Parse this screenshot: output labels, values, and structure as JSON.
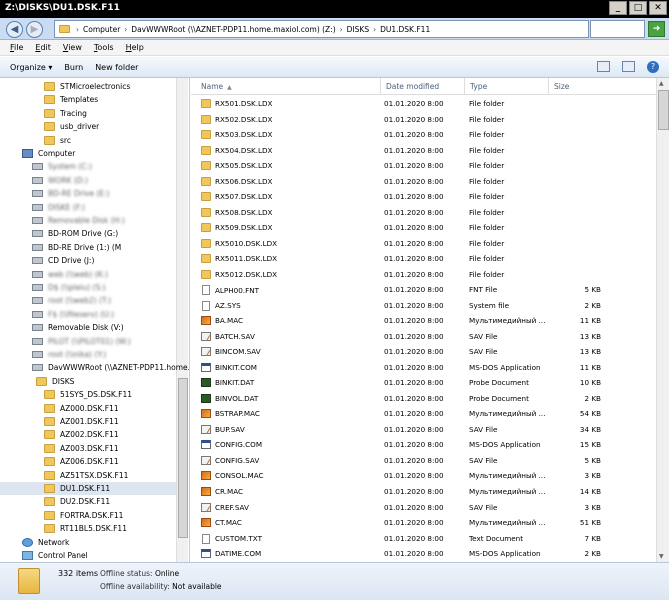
{
  "window": {
    "title": "Z:\\DISKS\\DU1.DSK.F11"
  },
  "address": {
    "crumbs": [
      "Computer",
      "DavWWWRoot (\\\\AZNET-PDP11.home.maxiol.com) (Z:)",
      "DISKS",
      "DU1.DSK.F11"
    ]
  },
  "menu": {
    "items": [
      "File",
      "Edit",
      "View",
      "Tools",
      "Help"
    ]
  },
  "toolbar": {
    "organize": "Organize ▾",
    "burn": "Burn",
    "new_folder": "New folder"
  },
  "columns": {
    "name": "Name",
    "date": "Date modified",
    "type": "Type",
    "size": "Size"
  },
  "nav": {
    "items": [
      {
        "label": "STMicroelectronics",
        "icon": "folder",
        "indent": 44
      },
      {
        "label": "Templates",
        "icon": "folder",
        "indent": 44
      },
      {
        "label": "Tracing",
        "icon": "folder",
        "indent": 44
      },
      {
        "label": "usb_driver",
        "icon": "folder",
        "indent": 44
      },
      {
        "label": "src",
        "icon": "folder",
        "indent": 44
      },
      {
        "label": "Computer",
        "icon": "comp",
        "indent": 22
      },
      {
        "label": "System (C:)",
        "icon": "drive",
        "indent": 32,
        "blur": true
      },
      {
        "label": "WORK (D:)",
        "icon": "drive",
        "indent": 32,
        "blur": true
      },
      {
        "label": "BD-RE Drive (E:)",
        "icon": "drive",
        "indent": 32,
        "blur": true
      },
      {
        "label": "DISKE (F:)",
        "icon": "drive",
        "indent": 32,
        "blur": true
      },
      {
        "label": "Removable Disk (H:)",
        "icon": "drive",
        "indent": 32,
        "blur": true
      },
      {
        "label": "BD-ROM Drive (G:)",
        "icon": "drive",
        "indent": 32
      },
      {
        "label": "BD-RE Drive (1:) (M",
        "icon": "drive",
        "indent": 32
      },
      {
        "label": "CD Drive (J:)",
        "icon": "drive",
        "indent": 32
      },
      {
        "label": "web (\\\\web) (K:)",
        "icon": "drive",
        "indent": 32,
        "blur": true
      },
      {
        "label": "D$ (\\\\pleiu) (S:)",
        "icon": "drive",
        "indent": 32,
        "blur": true
      },
      {
        "label": "root (\\\\web2) (T:)",
        "icon": "drive",
        "indent": 32,
        "blur": true
      },
      {
        "label": "F$ (\\\\fileserv) (U:)",
        "icon": "drive",
        "indent": 32,
        "blur": true
      },
      {
        "label": "Removable Disk (V:)",
        "icon": "drive",
        "indent": 32
      },
      {
        "label": "PILOT (\\\\PILOT01) (W:)",
        "icon": "drive",
        "indent": 32,
        "blur": true
      },
      {
        "label": "root (\\\\nika) (Y:)",
        "icon": "drive",
        "indent": 32,
        "blur": true
      },
      {
        "label": "DavWWWRoot (\\\\AZNET-PDP11.home.",
        "icon": "drive",
        "indent": 32
      },
      {
        "label": "DISKS",
        "icon": "folder",
        "indent": 36
      },
      {
        "label": "51SYS_DS.DSK.F11",
        "icon": "folder",
        "indent": 44
      },
      {
        "label": "AZ000.DSK.F11",
        "icon": "folder",
        "indent": 44
      },
      {
        "label": "AZ001.DSK.F11",
        "icon": "folder",
        "indent": 44
      },
      {
        "label": "AZ002.DSK.F11",
        "icon": "folder",
        "indent": 44
      },
      {
        "label": "AZ003.DSK.F11",
        "icon": "folder",
        "indent": 44
      },
      {
        "label": "AZ006.DSK.F11",
        "icon": "folder",
        "indent": 44
      },
      {
        "label": "AZ51TSX.DSK.F11",
        "icon": "folder",
        "indent": 44
      },
      {
        "label": "DU1.DSK.F11",
        "icon": "folder",
        "indent": 44,
        "selected": true
      },
      {
        "label": "DU2.DSK.F11",
        "icon": "folder",
        "indent": 44
      },
      {
        "label": "FORTRA.DSK.F11",
        "icon": "folder",
        "indent": 44
      },
      {
        "label": "RT11BL5.DSK.F11",
        "icon": "folder",
        "indent": 44
      },
      {
        "label": "Network",
        "icon": "net",
        "indent": 22
      },
      {
        "label": "Control Panel",
        "icon": "cp",
        "indent": 22
      }
    ]
  },
  "files": [
    {
      "name": "RX501.DSK.LDX",
      "date": "01.01.2020 8:00",
      "type": "File folder",
      "size": "",
      "icon": "folder"
    },
    {
      "name": "RX502.DSK.LDX",
      "date": "01.01.2020 8:00",
      "type": "File folder",
      "size": "",
      "icon": "folder"
    },
    {
      "name": "RX503.DSK.LDX",
      "date": "01.01.2020 8:00",
      "type": "File folder",
      "size": "",
      "icon": "folder"
    },
    {
      "name": "RX504.DSK.LDX",
      "date": "01.01.2020 8:00",
      "type": "File folder",
      "size": "",
      "icon": "folder"
    },
    {
      "name": "RX505.DSK.LDX",
      "date": "01.01.2020 8:00",
      "type": "File folder",
      "size": "",
      "icon": "folder"
    },
    {
      "name": "RX506.DSK.LDX",
      "date": "01.01.2020 8:00",
      "type": "File folder",
      "size": "",
      "icon": "folder"
    },
    {
      "name": "RX507.DSK.LDX",
      "date": "01.01.2020 8:00",
      "type": "File folder",
      "size": "",
      "icon": "folder"
    },
    {
      "name": "RX508.DSK.LDX",
      "date": "01.01.2020 8:00",
      "type": "File folder",
      "size": "",
      "icon": "folder"
    },
    {
      "name": "RX509.DSK.LDX",
      "date": "01.01.2020 8:00",
      "type": "File folder",
      "size": "",
      "icon": "folder"
    },
    {
      "name": "RX5010.DSK.LDX",
      "date": "01.01.2020 8:00",
      "type": "File folder",
      "size": "",
      "icon": "folder"
    },
    {
      "name": "RX5011.DSK.LDX",
      "date": "01.01.2020 8:00",
      "type": "File folder",
      "size": "",
      "icon": "folder"
    },
    {
      "name": "RX5012.DSK.LDX",
      "date": "01.01.2020 8:00",
      "type": "File folder",
      "size": "",
      "icon": "folder"
    },
    {
      "name": "ALPH00.FNT",
      "date": "01.01.2020 8:00",
      "type": "FNT File",
      "size": "5 KB",
      "icon": "file"
    },
    {
      "name": "AZ.SYS",
      "date": "01.01.2020 8:00",
      "type": "System file",
      "size": "2 KB",
      "icon": "file"
    },
    {
      "name": "BA.MAC",
      "date": "01.01.2020 8:00",
      "type": "Мультимедийный ...",
      "size": "11 KB",
      "icon": "mac"
    },
    {
      "name": "BATCH.SAV",
      "date": "01.01.2020 8:00",
      "type": "SAV File",
      "size": "13 KB",
      "icon": "sav"
    },
    {
      "name": "BINCOM.SAV",
      "date": "01.01.2020 8:00",
      "type": "SAV File",
      "size": "13 KB",
      "icon": "sav"
    },
    {
      "name": "BINKIT.COM",
      "date": "01.01.2020 8:00",
      "type": "MS-DOS Application",
      "size": "11 KB",
      "icon": "com"
    },
    {
      "name": "BINKIT.DAT",
      "date": "01.01.2020 8:00",
      "type": "Probe Document",
      "size": "10 KB",
      "icon": "dat"
    },
    {
      "name": "BINVOL.DAT",
      "date": "01.01.2020 8:00",
      "type": "Probe Document",
      "size": "2 KB",
      "icon": "dat"
    },
    {
      "name": "BSTRAP.MAC",
      "date": "01.01.2020 8:00",
      "type": "Мультимедийный ...",
      "size": "54 KB",
      "icon": "mac"
    },
    {
      "name": "BUP.SAV",
      "date": "01.01.2020 8:00",
      "type": "SAV File",
      "size": "34 KB",
      "icon": "sav"
    },
    {
      "name": "CONFIG.COM",
      "date": "01.01.2020 8:00",
      "type": "MS-DOS Application",
      "size": "15 KB",
      "icon": "com"
    },
    {
      "name": "CONFIG.SAV",
      "date": "01.01.2020 8:00",
      "type": "SAV File",
      "size": "5 KB",
      "icon": "sav"
    },
    {
      "name": "CONSOL.MAC",
      "date": "01.01.2020 8:00",
      "type": "Мультимедийный ...",
      "size": "3 KB",
      "icon": "mac"
    },
    {
      "name": "CR.MAC",
      "date": "01.01.2020 8:00",
      "type": "Мультимедийный ...",
      "size": "14 KB",
      "icon": "mac"
    },
    {
      "name": "CREF.SAV",
      "date": "01.01.2020 8:00",
      "type": "SAV File",
      "size": "3 KB",
      "icon": "sav"
    },
    {
      "name": "CT.MAC",
      "date": "01.01.2020 8:00",
      "type": "Мультимедийный ...",
      "size": "51 KB",
      "icon": "mac"
    },
    {
      "name": "CUSTOM.TXT",
      "date": "01.01.2020 8:00",
      "type": "Text Document",
      "size": "7 KB",
      "icon": "txt"
    },
    {
      "name": "DATIME.COM",
      "date": "01.01.2020 8:00",
      "type": "MS-DOS Application",
      "size": "2 KB",
      "icon": "com"
    }
  ],
  "details": {
    "count": "332 items",
    "offline_status_label": "Offline status:",
    "offline_status_value": "Online",
    "offline_avail_label": "Offline availability:",
    "offline_avail_value": "Not available"
  }
}
